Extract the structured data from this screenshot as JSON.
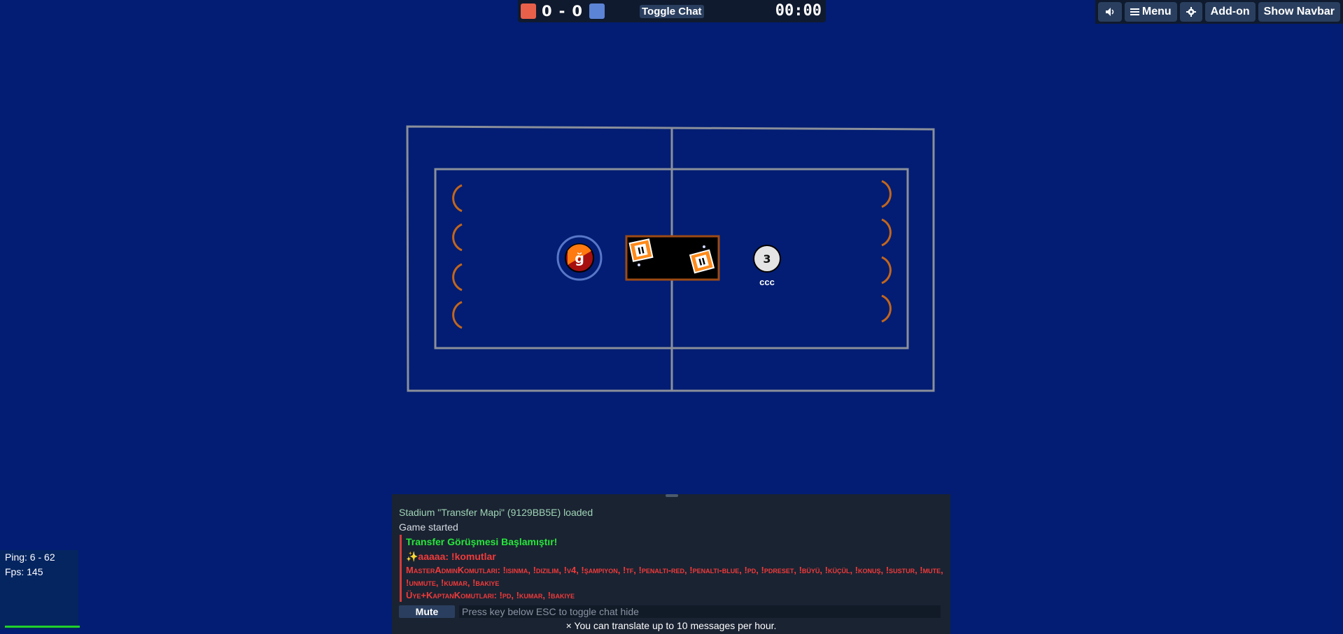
{
  "scoreboard": {
    "red_color": "#e8604a",
    "blue_color": "#5c84d6",
    "red_score": "0",
    "separator": "-",
    "blue_score": "0",
    "toggle_chat_label": "Toggle Chat",
    "timer": "00:00"
  },
  "topbar": {
    "sound_icon": "speaker-icon",
    "menu_icon": "hamburger-icon",
    "menu_label": "Menu",
    "settings_icon": "gear-icon",
    "addon_label": "Add-on",
    "navbar_label": "Show Navbar"
  },
  "field": {
    "red_player_avatar": "ğ",
    "blue_player_avatar": "3",
    "blue_player_name": "ccc",
    "goal_box_marks": [
      "II",
      "II"
    ]
  },
  "chat": {
    "messages": [
      {
        "kind": "sys",
        "text": "Stadium \"Transfer Mapi\" (9129BB5E) loaded"
      },
      {
        "kind": "plain",
        "text": "Game started"
      },
      {
        "kind": "announce-green",
        "text": "Transfer Görüşmesi Başlamıştır!"
      },
      {
        "kind": "announce-red",
        "text": "✨aaaaa: !komutlar"
      },
      {
        "kind": "announce-red-sc",
        "text": "MasterAdminKomutları: !ısınma, !dizilim, !v4, !şampiyon, !tf, !penaltı-red, !penaltı-blue, !pd, !pdreset, !büyü, !küçül, !konuş, !sustur, !mute, !unmute, !kumar, !bakiye"
      },
      {
        "kind": "announce-red-sc",
        "text": "Üye+KaptanKomutları: !pd, !kumar, !bakiye"
      }
    ],
    "mute_label": "Mute",
    "input_placeholder": "Press key below ESC to toggle chat hide",
    "translate_note": "× You can translate up to 10 messages per hour."
  },
  "stats": {
    "ping": "Ping: 6 - 62",
    "fps": "Fps: 145"
  }
}
